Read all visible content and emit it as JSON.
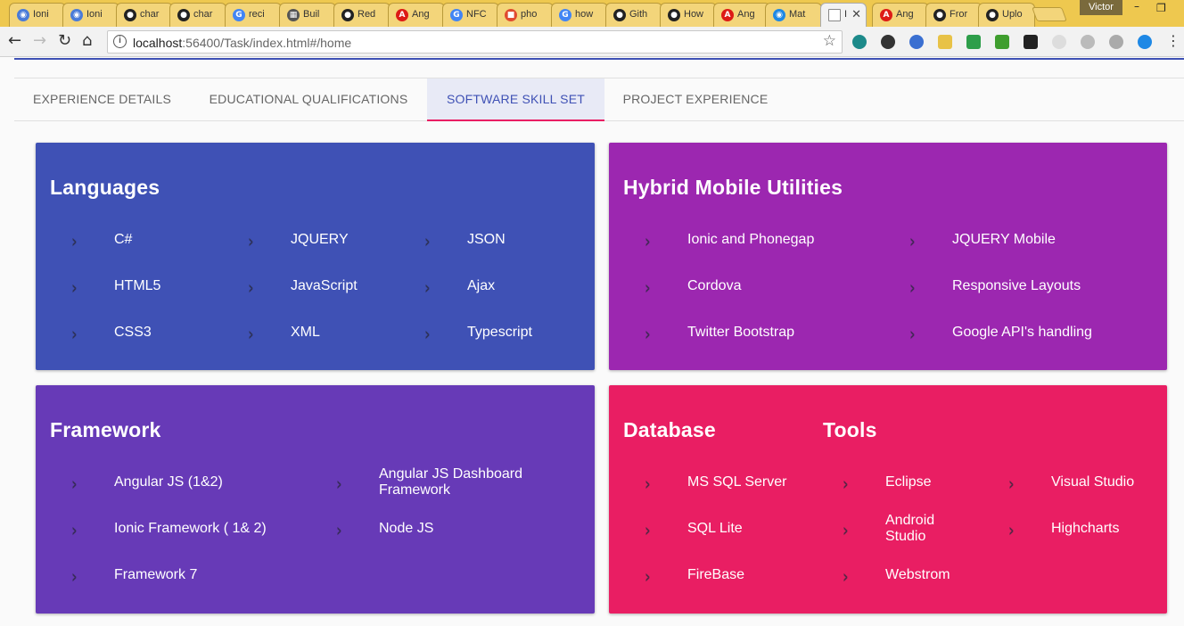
{
  "browser": {
    "tabs": [
      {
        "title": "Ioni",
        "icon": "ionic-icon",
        "color": "#4a7bd8"
      },
      {
        "title": "Ioni",
        "icon": "ionic-icon",
        "color": "#4a7bd8"
      },
      {
        "title": "char",
        "icon": "github-icon",
        "color": "#222222"
      },
      {
        "title": "char",
        "icon": "github-icon",
        "color": "#222222"
      },
      {
        "title": "reci",
        "icon": "google-icon",
        "color": "#4285f4"
      },
      {
        "title": "Buil",
        "icon": "office-icon",
        "color": "#555555"
      },
      {
        "title": "Red",
        "icon": "github-icon",
        "color": "#222222"
      },
      {
        "title": "Ang",
        "icon": "angular-icon",
        "color": "#dd1b16"
      },
      {
        "title": "NFC",
        "icon": "google-icon",
        "color": "#4285f4"
      },
      {
        "title": "pho",
        "icon": "page-icon",
        "color": "#e04b2f"
      },
      {
        "title": "how",
        "icon": "google-icon",
        "color": "#4285f4"
      },
      {
        "title": "Gith",
        "icon": "github-icon",
        "color": "#222222"
      },
      {
        "title": "How",
        "icon": "github-icon",
        "color": "#222222"
      },
      {
        "title": "Ang",
        "icon": "angular-icon",
        "color": "#dd1b16"
      },
      {
        "title": "Mat",
        "icon": "material-icon",
        "color": "#1e88e5"
      },
      {
        "title": "I",
        "icon": "document-icon",
        "color": "#888888",
        "active": true
      },
      {
        "title": "Ang",
        "icon": "angular-icon",
        "color": "#dd1b16"
      },
      {
        "title": "Fror",
        "icon": "github-icon",
        "color": "#222222"
      },
      {
        "title": "Uplo",
        "icon": "github-icon",
        "color": "#222222"
      }
    ],
    "user": "Victor",
    "url_host": "localhost",
    "url_rest": ":56400/Task/index.html#/home"
  },
  "app": {
    "tabs": [
      {
        "label": "EXPERIENCE DETAILS"
      },
      {
        "label": "EDUCATIONAL QUALIFICATIONS"
      },
      {
        "label": "SOFTWARE SKILL SET",
        "active": true
      },
      {
        "label": "PROJECT EXPERIENCE"
      }
    ],
    "colors": {
      "indigo": "#3f51b5",
      "purple": "#9c27b0",
      "deep_purple": "#673ab7",
      "pink": "#e91e63",
      "tab_ink": "#e91e63"
    },
    "cards": {
      "languages": {
        "title": "Languages",
        "items": [
          "C#",
          "JQUERY",
          "JSON",
          "HTML5",
          "JavaScript",
          "Ajax",
          "CSS3",
          "XML",
          "Typescript"
        ]
      },
      "hybrid": {
        "title": "Hybrid Mobile Utilities",
        "items": [
          "Ionic and Phonegap",
          "JQUERY Mobile",
          "Cordova",
          "Responsive Layouts",
          "Twitter Bootstrap",
          "Google API's handling"
        ]
      },
      "framework": {
        "title": "Framework",
        "items": [
          "Angular JS (1&2)",
          "Angular JS Dashboard Framework",
          "Ionic Framework ( 1& 2)",
          "Node JS",
          "Framework 7"
        ]
      },
      "database": {
        "title": "Database",
        "items": [
          "MS SQL Server",
          "SQL Lite",
          "FireBase"
        ]
      },
      "tools": {
        "title": "Tools",
        "items": [
          "Eclipse",
          "Visual Studio",
          "Android Studio",
          "Highcharts",
          "Webstrom"
        ]
      }
    }
  }
}
